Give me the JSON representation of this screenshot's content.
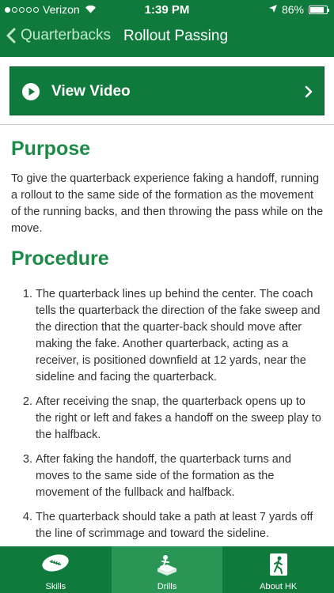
{
  "status_bar": {
    "carrier": "Verizon",
    "time": "1:39 PM",
    "battery": "86%"
  },
  "nav": {
    "back_label": "Quarterbacks",
    "title": "Rollout Passing"
  },
  "video_button": {
    "label": "View Video"
  },
  "purpose": {
    "heading": "Purpose",
    "text": "To give the quarterback experience faking a handoff, running a rollout to the same side of the formation as the movement of the running backs, and then throwing the pass while on the move."
  },
  "procedure": {
    "heading": "Procedure",
    "steps": [
      "The quarterback lines up behind the center. The coach tells the quarterback the direction of the fake sweep and the direction that the quarter-back should move after making the fake. Another quarterback, acting as a receiver, is positioned downfield at 12 yards, near the sideline and facing the quarterback.",
      "After receiving the snap, the quarterback opens up to the right or left and fakes a handoff on the sweep play to the halfback.",
      "After faking the handoff, the quarterback turns and moves to the same side of the formation as the movement of the fullback and halfback.",
      "The quarterback should take a path at least 7 yards off the line of scrimmage and toward the sideline."
    ]
  },
  "tabs": [
    {
      "label": "Skills",
      "icon": "football-icon",
      "active": false
    },
    {
      "label": "Drills",
      "icon": "drills-icon",
      "active": true
    },
    {
      "label": "About HK",
      "icon": "about-hk-icon",
      "active": false
    }
  ],
  "colors": {
    "primary_green": "#0f7a3c",
    "heading_green": "#1e8a47",
    "active_tab": "#2a9656"
  }
}
